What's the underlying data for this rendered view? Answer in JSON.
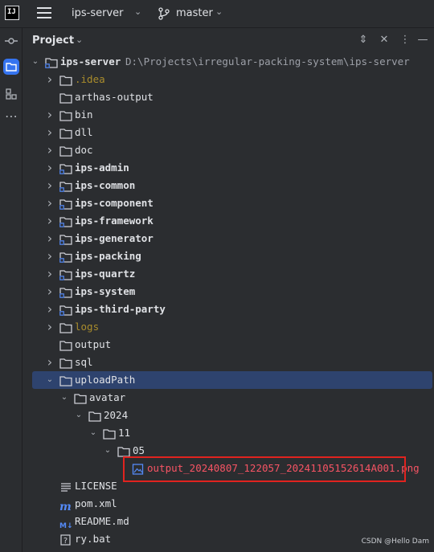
{
  "topbar": {
    "logo_text": "IJ",
    "project_name": "ips-server",
    "branch_name": "master"
  },
  "panel": {
    "title": "Project"
  },
  "tree": [
    {
      "label": "ips-server",
      "path": "D:\\Projects\\irregular-packing-system\\ips-server",
      "arrow": "down",
      "icon": "module-folder",
      "bold": true,
      "level": 0
    },
    {
      "label": ".idea",
      "arrow": "right",
      "icon": "folder",
      "style": "dim",
      "level": 1
    },
    {
      "label": "arthas-output",
      "arrow": "none",
      "icon": "folder",
      "level": 1
    },
    {
      "label": "bin",
      "arrow": "right",
      "icon": "folder",
      "level": 1
    },
    {
      "label": "dll",
      "arrow": "right",
      "icon": "folder",
      "level": 1
    },
    {
      "label": "doc",
      "arrow": "right",
      "icon": "folder",
      "level": 1
    },
    {
      "label": "ips-admin",
      "arrow": "right",
      "icon": "module-folder",
      "bold": true,
      "level": 1
    },
    {
      "label": "ips-common",
      "arrow": "right",
      "icon": "module-folder",
      "bold": true,
      "level": 1
    },
    {
      "label": "ips-component",
      "arrow": "right",
      "icon": "module-folder",
      "bold": true,
      "level": 1
    },
    {
      "label": "ips-framework",
      "arrow": "right",
      "icon": "module-folder",
      "bold": true,
      "level": 1
    },
    {
      "label": "ips-generator",
      "arrow": "right",
      "icon": "module-folder",
      "bold": true,
      "level": 1
    },
    {
      "label": "ips-packing",
      "arrow": "right",
      "icon": "module-folder",
      "bold": true,
      "level": 1
    },
    {
      "label": "ips-quartz",
      "arrow": "right",
      "icon": "module-folder",
      "bold": true,
      "level": 1
    },
    {
      "label": "ips-system",
      "arrow": "right",
      "icon": "module-folder",
      "bold": true,
      "level": 1
    },
    {
      "label": "ips-third-party",
      "arrow": "right",
      "icon": "module-folder",
      "bold": true,
      "level": 1
    },
    {
      "label": "logs",
      "arrow": "right",
      "icon": "folder",
      "style": "dim",
      "level": 1
    },
    {
      "label": "output",
      "arrow": "none",
      "icon": "folder",
      "level": 1
    },
    {
      "label": "sql",
      "arrow": "right",
      "icon": "folder",
      "level": 1
    },
    {
      "label": "uploadPath",
      "arrow": "down",
      "icon": "folder",
      "selected": true,
      "level": 1
    },
    {
      "label": "avatar",
      "arrow": "down",
      "icon": "folder",
      "level": 2
    },
    {
      "label": "2024",
      "arrow": "down",
      "icon": "folder",
      "level": 3
    },
    {
      "label": "11",
      "arrow": "down",
      "icon": "folder",
      "level": 4
    },
    {
      "label": "05",
      "arrow": "down",
      "icon": "folder",
      "level": 5
    },
    {
      "label": "output_20240807_122057_20241105152614A001.png",
      "arrow": "none",
      "icon": "image-file",
      "style": "red",
      "level": 6
    },
    {
      "label": "LICENSE",
      "arrow": "none",
      "icon": "text-file",
      "level": 1
    },
    {
      "label": "pom.xml",
      "arrow": "none",
      "icon": "maven-file",
      "level": 1
    },
    {
      "label": "README.md",
      "arrow": "none",
      "icon": "markdown-file",
      "level": 1
    },
    {
      "label": "ry.bat",
      "arrow": "none",
      "icon": "unknown-file",
      "level": 1
    }
  ],
  "watermark": "CSDN @Hello Dam",
  "colors": {
    "background": "#2b2d30",
    "selection": "#2e436e",
    "accent": "#3574f0",
    "highlight_border": "#e0231f",
    "error_text": "#f75464",
    "excluded_text": "#a98c2c"
  }
}
